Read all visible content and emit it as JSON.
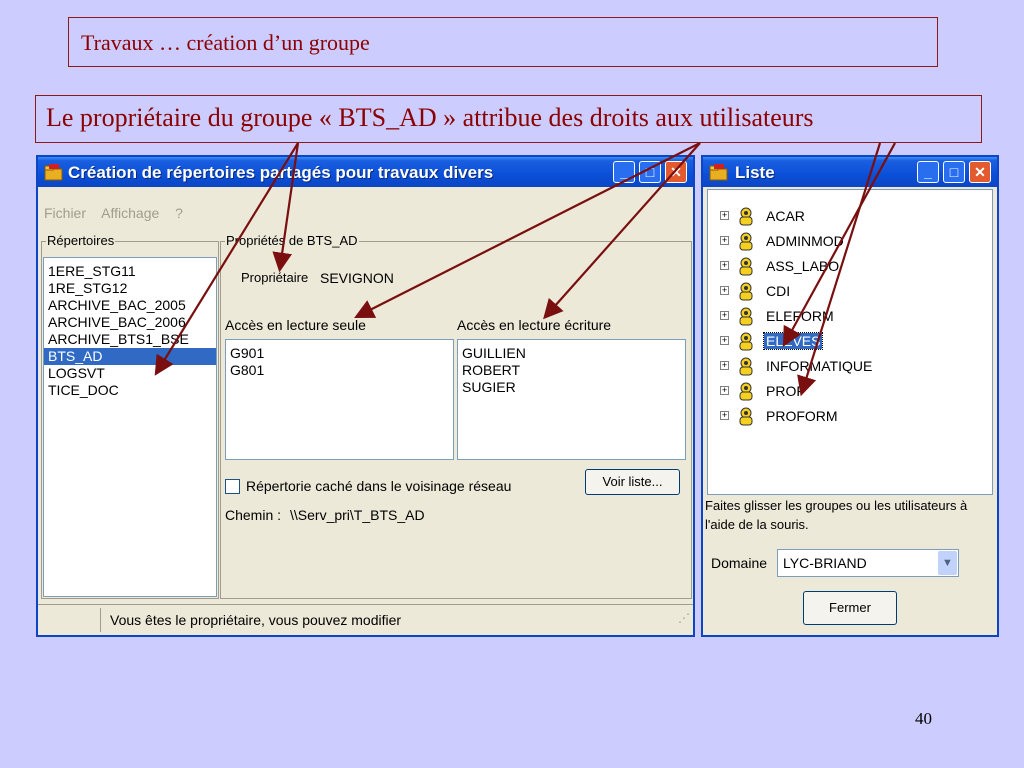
{
  "slide": {
    "title": "Travaux … création d’un groupe",
    "subtitle": "Le propriétaire du groupe « BTS_AD » attribue des droits aux utilisateurs",
    "page_number": "40"
  },
  "main_window": {
    "title": "Création de répertoires partagés pour travaux divers",
    "menu": [
      "Fichier",
      "Affichage",
      "?"
    ],
    "repertoires": {
      "legend": "Répertoires",
      "items": [
        "1ERE_STG11",
        "1RE_STG12",
        "ARCHIVE_BAC_2005",
        "ARCHIVE_BAC_2006",
        "ARCHIVE_BTS1_BSE",
        "BTS_AD",
        "LOGSVT",
        "TICE_DOC"
      ],
      "selected": "BTS_AD"
    },
    "properties": {
      "legend": "Propriétés de BTS_AD",
      "owner_label": "Propriétaire",
      "owner_value": "SEVIGNON",
      "read_only_label": "Accès en lecture seule",
      "read_only_items": [
        "G901",
        "G801"
      ],
      "read_write_label": "Accès en lecture écriture",
      "read_write_items": [
        "GUILLIEN",
        "ROBERT",
        "SUGIER"
      ],
      "hidden_checkbox_label": "Répertorie caché dans le voisinage réseau",
      "voir_liste_button": "Voir liste...",
      "path_label": "Chemin :",
      "path_value": "\\\\Serv_pri\\T_BTS_AD"
    },
    "status": "Vous êtes le propriétaire, vous pouvez modifier"
  },
  "list_window": {
    "title": "Liste",
    "tree_items": [
      "ACAR",
      "ADMINMOD",
      "ASS_LABO",
      "CDI",
      "ELEFORM",
      "ELEVES",
      "INFORMATIQUE",
      "PROF",
      "PROFORM"
    ],
    "selected": "ELEVES",
    "hint": "Faites glisser les groupes ou les utilisateurs à l'aide de la souris.",
    "domain_label": "Domaine",
    "domain_value": "LYC-BRIAND",
    "close_button": "Fermer"
  },
  "colors": {
    "background": "#ccccff",
    "title_text": "#8b0000",
    "arrow": "#7a0f0f",
    "titlebar": "#0a4fd8",
    "selection": "#316ac5"
  },
  "icons": {
    "app_icon": "folder-app-icon",
    "group_icon": "group-user-icon",
    "expand_icon": "plus-box-icon"
  }
}
